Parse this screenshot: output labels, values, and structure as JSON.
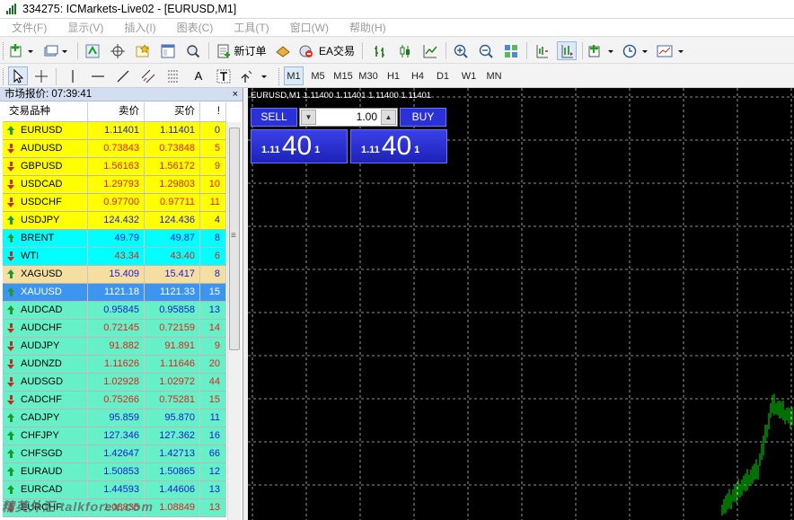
{
  "window": {
    "title": "334275: ICMarkets-Live02 - [EURUSD,M1]"
  },
  "menu": [
    "文件(F)",
    "显示(V)",
    "插入(I)",
    "图表(C)",
    "工具(T)",
    "窗口(W)",
    "帮助(H)"
  ],
  "toolbar": {
    "new_order": "新订单",
    "ea_trading": "EA交易"
  },
  "timeframes": [
    "M1",
    "M5",
    "M15",
    "M30",
    "H1",
    "H4",
    "D1",
    "W1",
    "MN"
  ],
  "drawing_tools": {
    "text": "A"
  },
  "market_watch": {
    "title": "市场报价: 07:39:41",
    "close": "×",
    "columns": [
      "交易品种",
      "卖价",
      "买价",
      "!"
    ],
    "rows": [
      {
        "symbol": "EURUSD",
        "bid": "1.11401",
        "ask": "1.11401",
        "spread": "0",
        "dir": "up",
        "bg": "#ffff00",
        "color": "#1a1adc"
      },
      {
        "symbol": "AUDUSD",
        "bid": "0.73843",
        "ask": "0.73848",
        "spread": "5",
        "dir": "down",
        "bg": "#ffff00",
        "color": "#e8201a"
      },
      {
        "symbol": "GBPUSD",
        "bid": "1.56163",
        "ask": "1.56172",
        "spread": "9",
        "dir": "down",
        "bg": "#ffff00",
        "color": "#e8201a"
      },
      {
        "symbol": "USDCAD",
        "bid": "1.29793",
        "ask": "1.29803",
        "spread": "10",
        "dir": "down",
        "bg": "#ffff00",
        "color": "#e8201a"
      },
      {
        "symbol": "USDCHF",
        "bid": "0.97700",
        "ask": "0.97711",
        "spread": "11",
        "dir": "down",
        "bg": "#ffff00",
        "color": "#e8201a"
      },
      {
        "symbol": "USDJPY",
        "bid": "124.432",
        "ask": "124.436",
        "spread": "4",
        "dir": "up",
        "bg": "#ffff00",
        "color": "#1a1adc"
      },
      {
        "symbol": "BRENT",
        "bid": "49.79",
        "ask": "49.87",
        "spread": "8",
        "dir": "up",
        "bg": "#00ffff",
        "color": "#1a1adc"
      },
      {
        "symbol": "WTI",
        "bid": "43.34",
        "ask": "43.40",
        "spread": "6",
        "dir": "down",
        "bg": "#00ffff",
        "color": "#e8201a"
      },
      {
        "symbol": "XAGUSD",
        "bid": "15.409",
        "ask": "15.417",
        "spread": "8",
        "dir": "up",
        "bg": "#f5dfa0",
        "color": "#1a1adc"
      },
      {
        "symbol": "XAUUSD",
        "bid": "1121.18",
        "ask": "1121.33",
        "spread": "15",
        "dir": "up",
        "bg": "#3d95f0",
        "color": "#ffffff"
      },
      {
        "symbol": "AUDCAD",
        "bid": "0.95845",
        "ask": "0.95858",
        "spread": "13",
        "dir": "up",
        "bg": "#66f0c8",
        "color": "#1a1adc"
      },
      {
        "symbol": "AUDCHF",
        "bid": "0.72145",
        "ask": "0.72159",
        "spread": "14",
        "dir": "down",
        "bg": "#66f0c8",
        "color": "#e8201a"
      },
      {
        "symbol": "AUDJPY",
        "bid": "91.882",
        "ask": "91.891",
        "spread": "9",
        "dir": "down",
        "bg": "#66f0c8",
        "color": "#e8201a"
      },
      {
        "symbol": "AUDNZD",
        "bid": "1.11626",
        "ask": "1.11646",
        "spread": "20",
        "dir": "down",
        "bg": "#66f0c8",
        "color": "#e8201a"
      },
      {
        "symbol": "AUDSGD",
        "bid": "1.02928",
        "ask": "1.02972",
        "spread": "44",
        "dir": "down",
        "bg": "#66f0c8",
        "color": "#e8201a"
      },
      {
        "symbol": "CADCHF",
        "bid": "0.75266",
        "ask": "0.75281",
        "spread": "15",
        "dir": "down",
        "bg": "#66f0c8",
        "color": "#e8201a"
      },
      {
        "symbol": "CADJPY",
        "bid": "95.859",
        "ask": "95.870",
        "spread": "11",
        "dir": "up",
        "bg": "#66f0c8",
        "color": "#1a1adc"
      },
      {
        "symbol": "CHFJPY",
        "bid": "127.346",
        "ask": "127.362",
        "spread": "16",
        "dir": "up",
        "bg": "#66f0c8",
        "color": "#1a1adc"
      },
      {
        "symbol": "CHFSGD",
        "bid": "1.42647",
        "ask": "1.42713",
        "spread": "66",
        "dir": "up",
        "bg": "#66f0c8",
        "color": "#1a1adc"
      },
      {
        "symbol": "EURAUD",
        "bid": "1.50853",
        "ask": "1.50865",
        "spread": "12",
        "dir": "up",
        "bg": "#66f0c8",
        "color": "#1a1adc"
      },
      {
        "symbol": "EURCAD",
        "bid": "1.44593",
        "ask": "1.44606",
        "spread": "13",
        "dir": "up",
        "bg": "#66f0c8",
        "color": "#1a1adc"
      },
      {
        "symbol": "EURCHF",
        "bid": "1.08835",
        "ask": "1.08849",
        "spread": "13",
        "dir": "down",
        "bg": "#66f0c8",
        "color": "#e8201a"
      }
    ]
  },
  "chart": {
    "header": "EURUSD,M1  1.11400 1.11401 1.11400 1.11401",
    "sell_label": "SELL",
    "buy_label": "BUY",
    "volume": "1.00",
    "sell_quote": {
      "prefix": "1.11",
      "big": "40",
      "sup": "1"
    },
    "buy_quote": {
      "prefix": "1.11",
      "big": "40",
      "sup": "1"
    },
    "background": "#000000",
    "grid_color": "#c0c0c0",
    "bar_color": "#00e000"
  },
  "watermark": "精英外汇 talkforex.com"
}
